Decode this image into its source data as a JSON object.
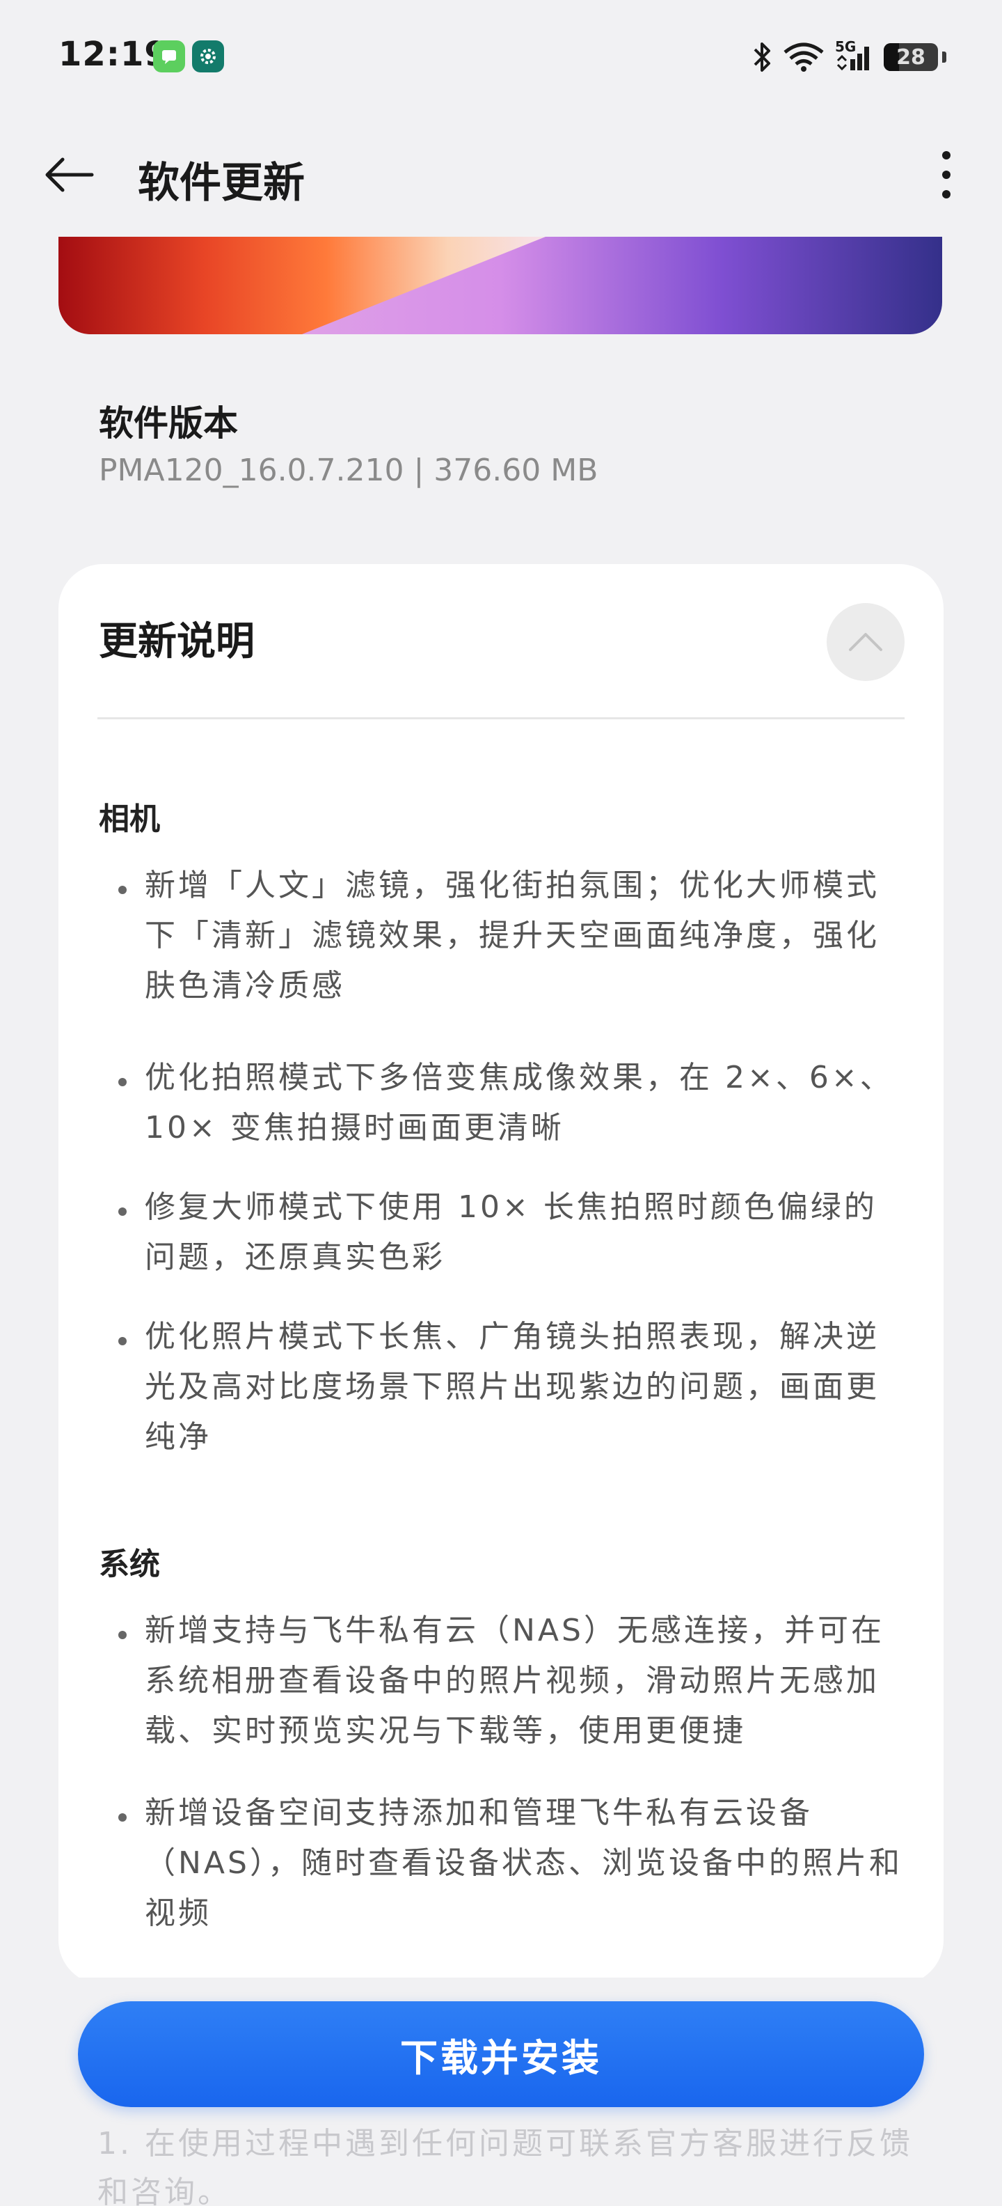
{
  "status_bar": {
    "time": "12:19",
    "network": "5G",
    "battery": "28",
    "icons": [
      "messages-app-icon",
      "settings-app-icon",
      "bluetooth-icon",
      "wifi-icon",
      "cellular-signal-icon",
      "battery-icon"
    ]
  },
  "header": {
    "title": "软件更新",
    "back_icon": "arrow-left-icon",
    "more_icon": "more-vertical-icon"
  },
  "version": {
    "label": "软件版本",
    "value": "PMA120_16.0.7.210 | 376.60 MB"
  },
  "release_notes": {
    "title": "更新说明",
    "collapse_icon": "chevron-up-icon",
    "sections": [
      {
        "title": "相机",
        "items": [
          "新增「人文」滤镜，强化街拍氛围；优化大师模式下「清新」滤镜效果，提升天空画面纯净度，强化肤色清冷质感",
          "优化拍照模式下多倍变焦成像效果，在 2×、6×、10× 变焦拍摄时画面更清晰",
          "修复大师模式下使用 10× 长焦拍照时颜色偏绿的问题，还原真实色彩",
          "优化照片模式下长焦、广角镜头拍照表现，解决逆光及高对比度场景下照片出现紫边的问题，画面更纯净"
        ]
      },
      {
        "title": "系统",
        "items": [
          "新增支持与飞牛私有云（NAS）无感连接，并可在系统相册查看设备中的照片视频，滑动照片无感加载、实时预览实况与下载等，使用更便捷",
          "新增设备空间支持添加和管理飞牛私有云设备（NAS），随时查看设备状态、浏览设备中的照片和视频"
        ]
      }
    ]
  },
  "footer": {
    "install_label": "下载并安装",
    "note": "1. 在使用过程中遇到任何问题可联系官方客服进行反馈和咨询。"
  },
  "colors": {
    "accent": "#1966ee",
    "background": "#f1f1f3",
    "card": "#ffffff"
  }
}
